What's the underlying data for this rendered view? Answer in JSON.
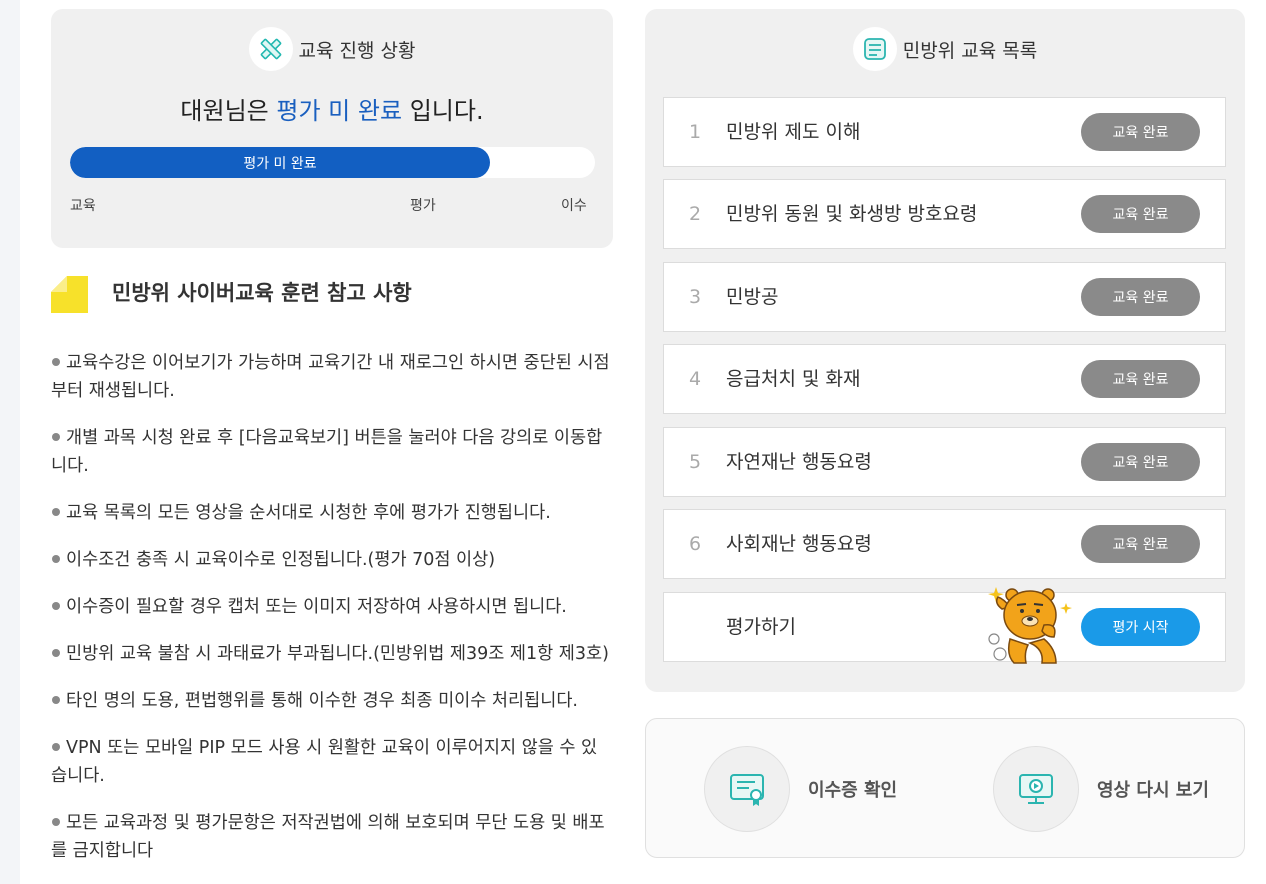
{
  "progress": {
    "title": "교육 진행 상황",
    "status_prefix": "대원님은",
    "status_highlight": "평가 미 완료",
    "status_suffix": "입니다.",
    "bar_label": "평가 미 완료",
    "bar_fraction": 0.8,
    "stages": [
      "교육",
      "평가",
      "이수"
    ]
  },
  "notice": {
    "title": "민방위 사이버교육 훈련 참고 사항",
    "items": [
      "교육수강은 이어보기가 가능하며 교육기간 내 재로그인 하시면 중단된 시점부터 재생됩니다.",
      "개별 과목 시청 완료 후 [다음교육보기] 버튼을 눌러야 다음 강의로 이동합니다.",
      "교육 목록의 모든 영상을 순서대로 시청한 후에 평가가 진행됩니다.",
      "이수조건 충족 시 교육이수로 인정됩니다.(평가 70점 이상)",
      "이수증이 필요할 경우 캡처 또는 이미지 저장하여 사용하시면 됩니다.",
      "민방위 교육 불참 시 과태료가 부과됩니다.(민방위법 제39조 제1항 제3호)",
      "타인 명의 도용, 편법행위를 통해 이수한 경우 최종 미이수 처리됩니다.",
      "VPN 또는 모바일 PIP 모드 사용 시 원활한 교육이 이루어지지 않을 수 있습니다.",
      "모든 교육과정 및 평가문항은 저작권법에 의해 보호되며 무단 도용 및 배포를 금지합니다"
    ]
  },
  "courses": {
    "title": "민방위 교육 목록",
    "items": [
      {
        "num": "1",
        "label": "민방위 제도 이해",
        "button": "교육 완료"
      },
      {
        "num": "2",
        "label": "민방위 동원 및 화생방 방호요령",
        "button": "교육 완료"
      },
      {
        "num": "3",
        "label": "민방공",
        "button": "교육 완료"
      },
      {
        "num": "4",
        "label": "응급처치 및 화재",
        "button": "교육 완료"
      },
      {
        "num": "5",
        "label": "자연재난 행동요령",
        "button": "교육 완료"
      },
      {
        "num": "6",
        "label": "사회재난 행동요령",
        "button": "교육 완료"
      }
    ],
    "evaluation": {
      "label": "평가하기",
      "button": "평가 시작"
    }
  },
  "actions": {
    "certificate_label": "이수증 확인",
    "replay_label": "영상 다시 보기"
  },
  "colors": {
    "accent_blue": "#125fc2",
    "button_gray": "#8a8a8a",
    "button_blue": "#1a9ae8",
    "notice_yellow": "#f7e12a"
  }
}
